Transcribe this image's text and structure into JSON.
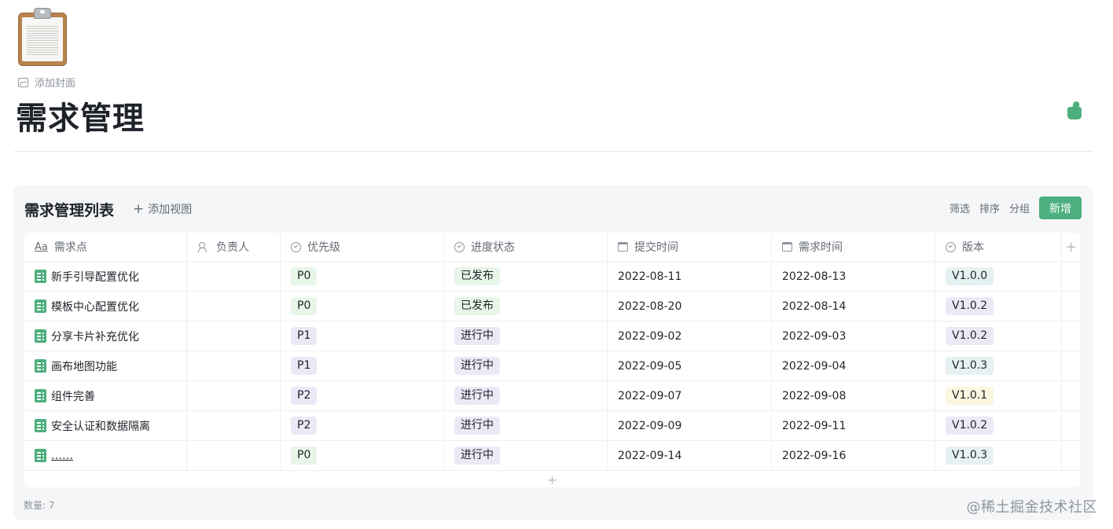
{
  "page": {
    "add_cover_label": "添加封面",
    "title": "需求管理"
  },
  "database": {
    "title": "需求管理列表",
    "add_view_label": "添加视图",
    "toolbar": {
      "filter_label": "筛选",
      "sort_label": "排序",
      "group_label": "分组",
      "new_label": "新增",
      "new_button_color": "#4caf7d"
    },
    "columns": [
      {
        "label": "需求点",
        "icon": "text-field-icon"
      },
      {
        "label": "负责人",
        "icon": "people-icon"
      },
      {
        "label": "优先级",
        "icon": "single-select-icon"
      },
      {
        "label": "进度状态",
        "icon": "single-select-icon"
      },
      {
        "label": "提交时间",
        "icon": "calendar-icon"
      },
      {
        "label": "需求时间",
        "icon": "calendar-icon"
      },
      {
        "label": "版本",
        "icon": "single-select-icon"
      }
    ],
    "rows": [
      {
        "name": "新手引导配置优化",
        "owner": "",
        "priority": "P0",
        "status": "已发布",
        "submitted": "2022-08-11",
        "required": "2022-08-13",
        "version": "V1.0.0"
      },
      {
        "name": "模板中心配置优化",
        "owner": "",
        "priority": "P0",
        "status": "已发布",
        "submitted": "2022-08-20",
        "required": "2022-08-14",
        "version": "V1.0.2"
      },
      {
        "name": "分享卡片补充优化",
        "owner": "",
        "priority": "P1",
        "status": "进行中",
        "submitted": "2022-09-02",
        "required": "2022-09-03",
        "version": "V1.0.2"
      },
      {
        "name": "画布地图功能",
        "owner": "",
        "priority": "P1",
        "status": "进行中",
        "submitted": "2022-09-05",
        "required": "2022-09-04",
        "version": "V1.0.3"
      },
      {
        "name": "组件完善",
        "owner": "",
        "priority": "P2",
        "status": "进行中",
        "submitted": "2022-09-07",
        "required": "2022-09-08",
        "version": "V1.0.1"
      },
      {
        "name": "安全认证和数据隔离",
        "owner": "",
        "priority": "P2",
        "status": "进行中",
        "submitted": "2022-09-09",
        "required": "2022-09-11",
        "version": "V1.0.2"
      },
      {
        "name": "……",
        "owner": "",
        "priority": "P0",
        "status": "进行中",
        "submitted": "2022-09-14",
        "required": "2022-09-16",
        "version": "V1.0.3"
      }
    ],
    "count_label": "数量: 7"
  },
  "watermark": "@稀土掘金技术社区"
}
